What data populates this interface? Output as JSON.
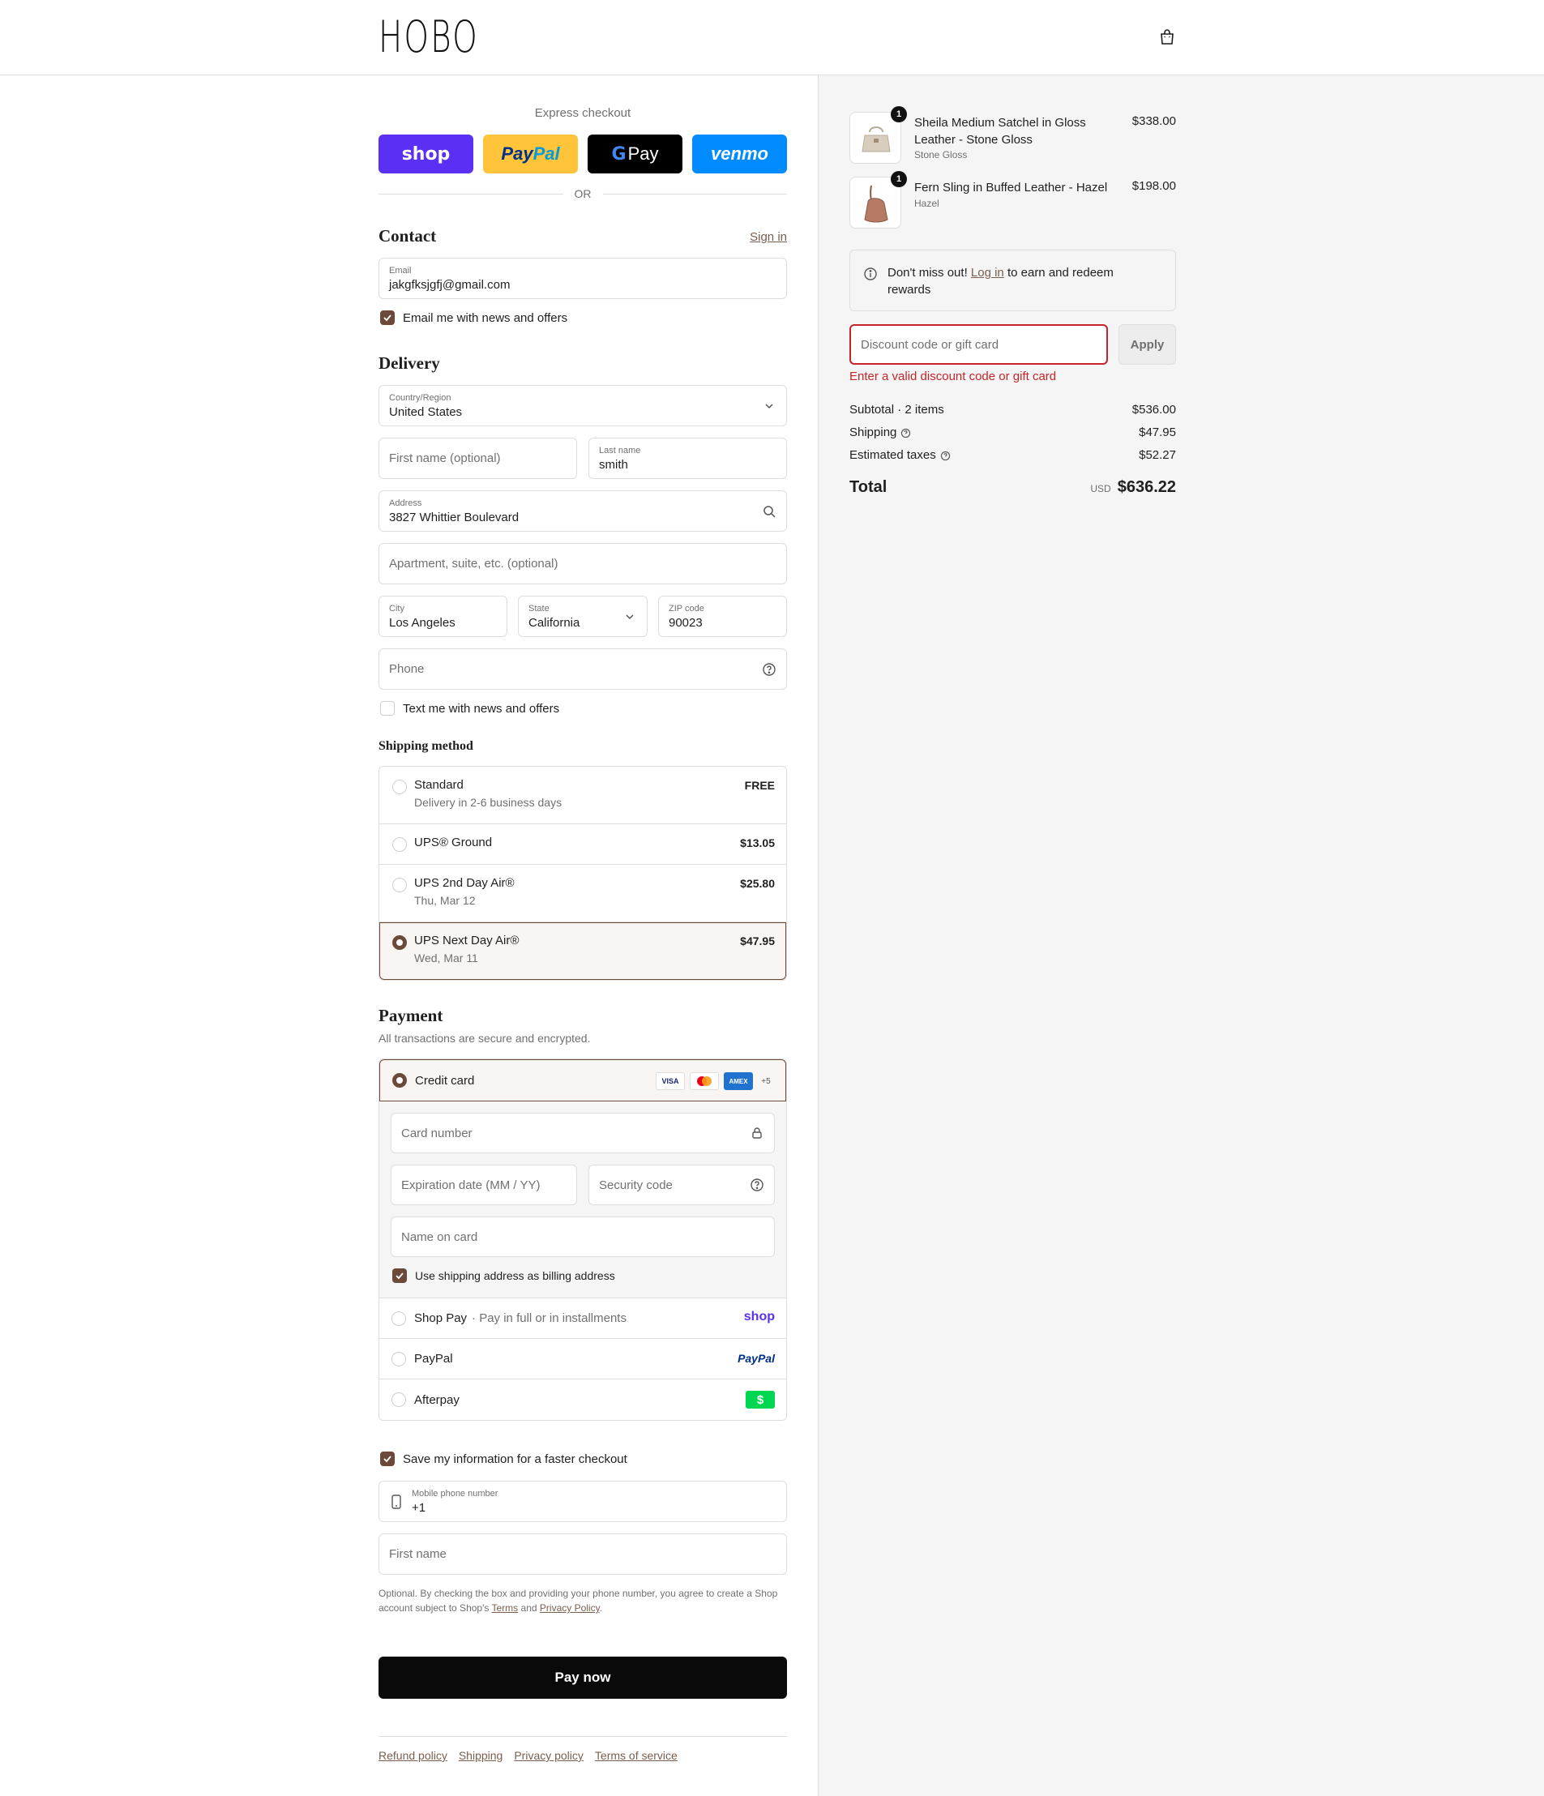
{
  "header": {
    "logo": "HOBO",
    "cart_icon": "shopping-bag-icon"
  },
  "express": {
    "label": "Express checkout",
    "buttons": {
      "shop": "shop",
      "paypal_a": "Pay",
      "paypal_b": "Pal",
      "gpay_g": "G",
      "gpay_text": "Pay",
      "venmo": "venmo"
    },
    "or": "OR"
  },
  "contact": {
    "title": "Contact",
    "sign_in": "Sign in",
    "email_label": "Email",
    "email_value": "jakgfksjgfj@gmail.com",
    "news_label": "Email me with news and offers",
    "news_checked": true
  },
  "delivery": {
    "title": "Delivery",
    "country_label": "Country/Region",
    "country_value": "United States",
    "first_name_placeholder": "First name (optional)",
    "last_name_label": "Last name",
    "last_name_value": "smith",
    "address_label": "Address",
    "address_value": "3827 Whittier Boulevard",
    "apt_placeholder": "Apartment, suite, etc. (optional)",
    "city_label": "City",
    "city_value": "Los Angeles",
    "state_label": "State",
    "state_value": "California",
    "zip_label": "ZIP code",
    "zip_value": "90023",
    "phone_placeholder": "Phone",
    "text_label": "Text me with news and offers",
    "text_checked": false
  },
  "shipping": {
    "title": "Shipping method",
    "options": [
      {
        "name": "Standard",
        "sub": "Delivery in 2-6 business days",
        "price": "FREE",
        "selected": false
      },
      {
        "name": "UPS® Ground",
        "sub": "",
        "price": "$13.05",
        "selected": false
      },
      {
        "name": "UPS 2nd Day Air®",
        "sub": "Thu, Mar 12",
        "price": "$25.80",
        "selected": false
      },
      {
        "name": "UPS Next Day Air®",
        "sub": "Wed, Mar 11",
        "price": "$47.95",
        "selected": true
      }
    ]
  },
  "payment": {
    "title": "Payment",
    "subtitle": "All transactions are secure and encrypted.",
    "credit_card": "Credit card",
    "card_logos": {
      "visa": "VISA",
      "amex": "AMEX",
      "more": "+5"
    },
    "card_number_placeholder": "Card number",
    "expiry_placeholder": "Expiration date (MM / YY)",
    "cvv_placeholder": "Security code",
    "name_placeholder": "Name on card",
    "billing_label": "Use shipping address as billing address",
    "billing_checked": true,
    "shop_pay": "Shop Pay",
    "shop_pay_sub": "· Pay in full or in installments",
    "shop_logo": "shop",
    "paypal": "PayPal",
    "paypal_logo": "PayPal",
    "afterpay": "Afterpay",
    "afterpay_logo": "$"
  },
  "save_info": {
    "label": "Save my information for a faster checkout",
    "checked": true,
    "mobile_label": "Mobile phone number",
    "mobile_value": "+1",
    "first_name_placeholder": "First name",
    "legal_a": "Optional. By checking the box and providing your phone number, you agree to create a Shop account subject to Shop's",
    "terms": "Terms",
    "and": "and",
    "privacy": "Privacy Policy",
    "period": "."
  },
  "pay_now": "Pay now",
  "footer": [
    "Refund policy",
    "Shipping",
    "Privacy policy",
    "Terms of service"
  ],
  "summary": {
    "items": [
      {
        "qty": "1",
        "name": "Sheila Medium Satchel in Gloss Leather - Stone Gloss",
        "variant": "Stone Gloss",
        "price": "$338.00"
      },
      {
        "qty": "1",
        "name": "Fern Sling in Buffed Leather - Hazel",
        "variant": "Hazel",
        "price": "$198.00"
      }
    ],
    "notice_a": "Don't miss out!",
    "notice_link": "Log in",
    "notice_b": "to earn and redeem rewards",
    "discount_placeholder": "Discount code or gift card",
    "apply": "Apply",
    "discount_error": "Enter a valid discount code or gift card",
    "subtotal_label": "Subtotal · 2 items",
    "subtotal_value": "$536.00",
    "shipping_label": "Shipping",
    "shipping_value": "$47.95",
    "taxes_label": "Estimated taxes",
    "taxes_value": "$52.27",
    "total_label": "Total",
    "currency": "USD",
    "total_value": "$636.22"
  },
  "colors": {
    "accent": "#6b4a3a",
    "error": "#c6242a",
    "shop": "#5a31f4",
    "paypal": "#ffc439",
    "venmo": "#008cff"
  }
}
